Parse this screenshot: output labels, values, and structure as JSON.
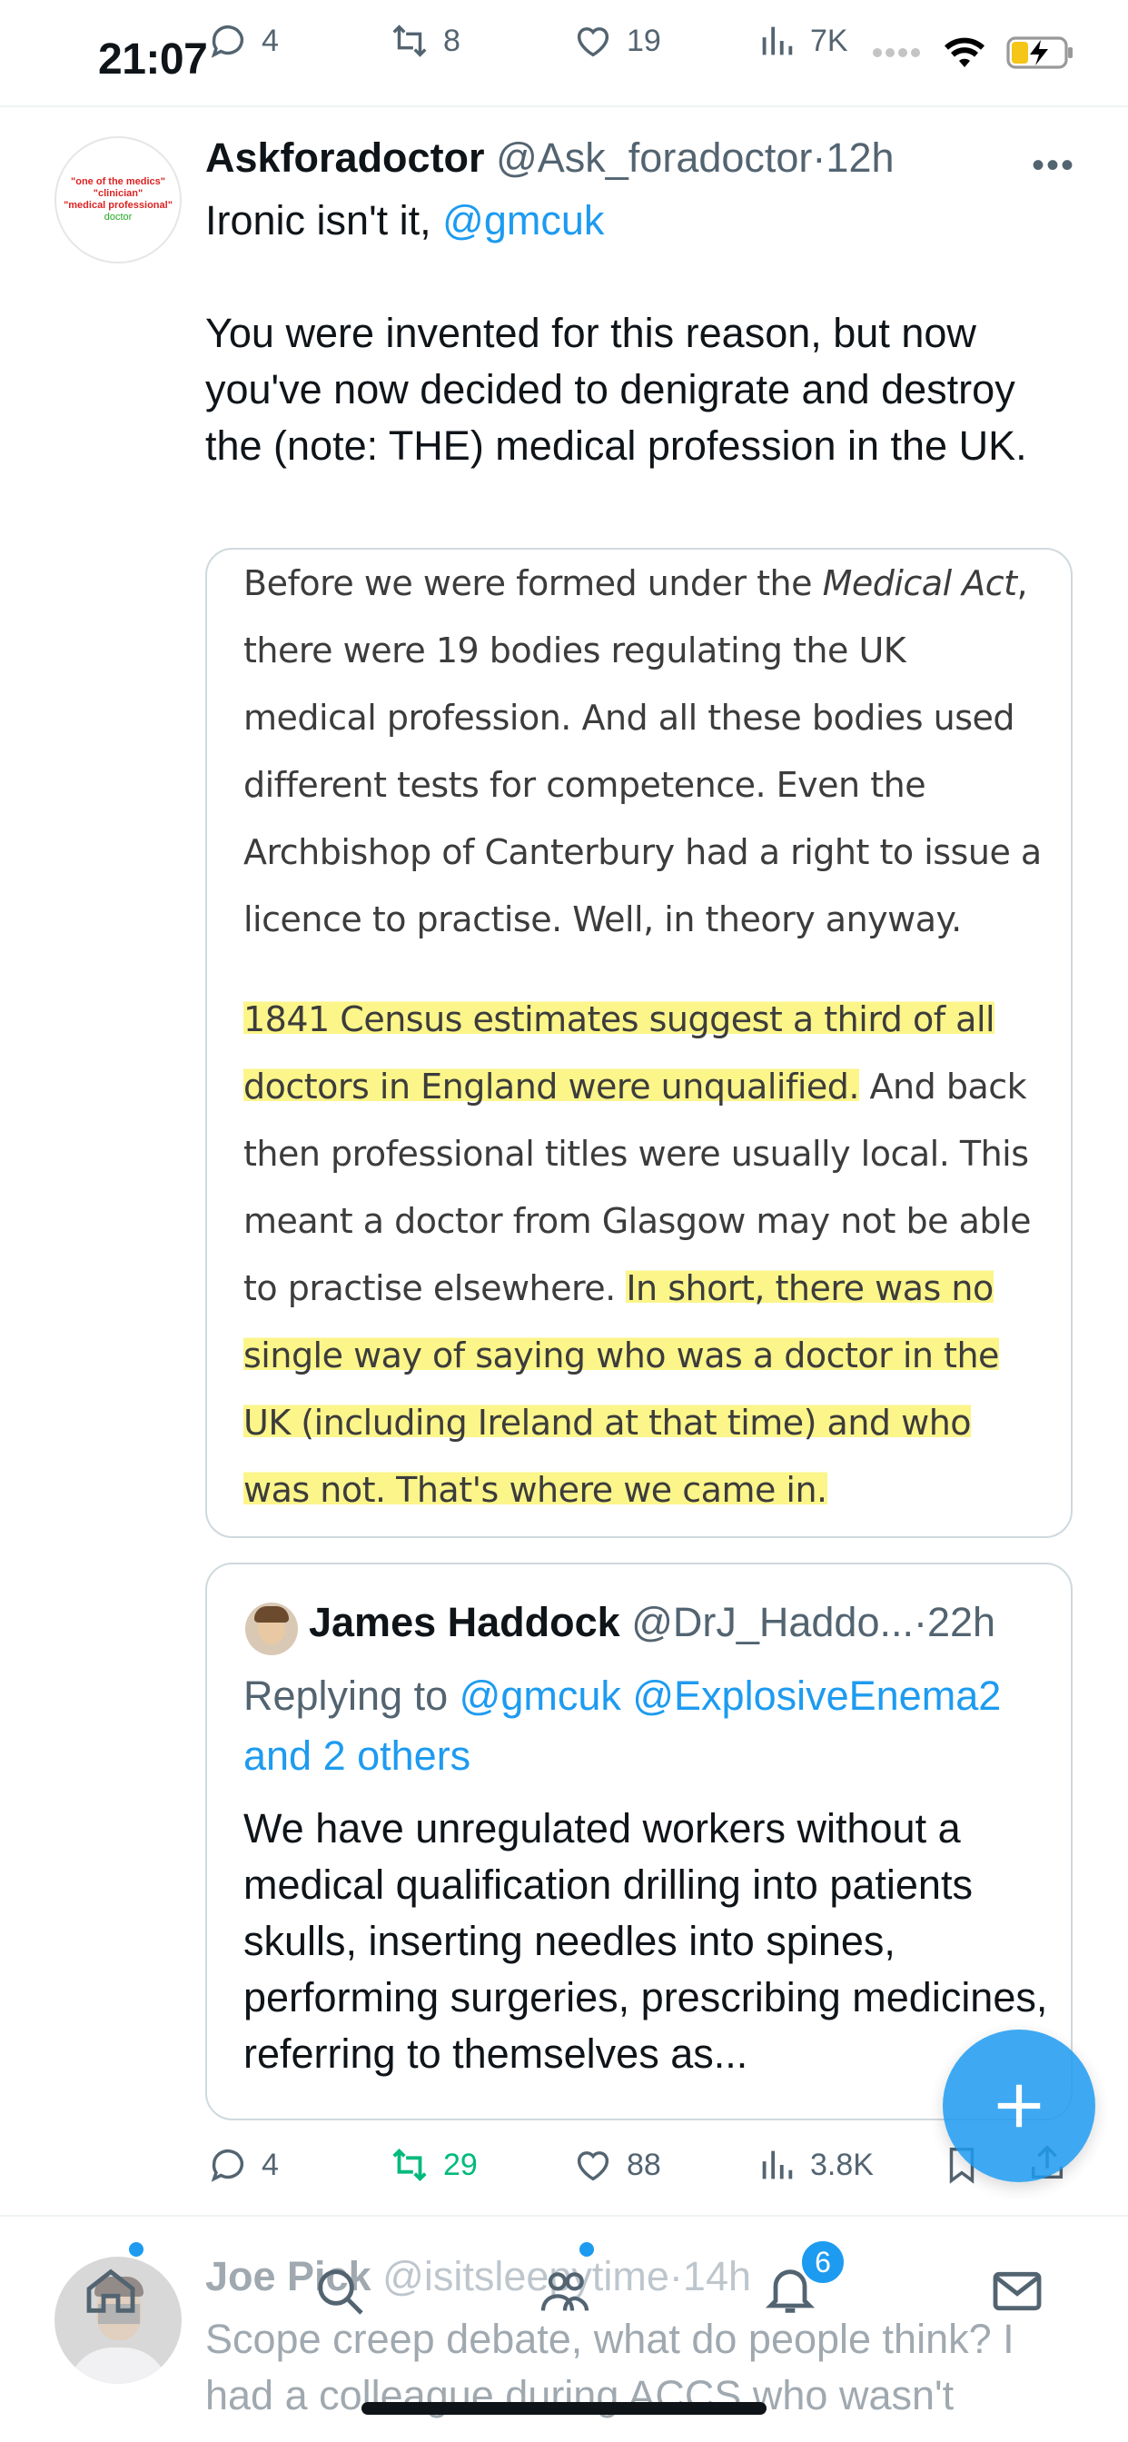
{
  "status_bar": {
    "time": "21:07"
  },
  "previous_tweet_actions": {
    "replies": "4",
    "reposts": "8",
    "likes": "19",
    "views": "7K"
  },
  "tweet": {
    "author_name": "Askforadoctor",
    "author_handle": "@Ask_foradoctor",
    "separator": "·",
    "timestamp": "12h",
    "avatar_lines": [
      "\"one of the medics\"",
      "\"clinician\"",
      "\"medical professional\"",
      "doctor"
    ],
    "text_line1_prefix": "Ironic isn't it, ",
    "text_line1_mention": "@gmcuk",
    "text_paragraph2": "You were invented for this reason, but now you've now decided to denigrate and destroy the (note: THE) medical profession in the UK."
  },
  "image_card": {
    "p1_before_italic": "Before we were formed under the ",
    "p1_italic": "Medical Act",
    "p1_after_italic": ", there were 19 bodies regulating the UK medical profession. And all these bodies used different tests for competence. Even the Archbishop of Canterbury had a right to issue a licence to practise. Well, in theory anyway.",
    "p2_highlight1": "1841 Census estimates suggest a third of all doctors in England were unqualified.",
    "p2_plain": " And back then professional titles were usually local. This meant a doctor from Glasgow may not be able to practise elsewhere. ",
    "p2_highlight2": "In short, there was no single way of saying who was a doctor in the UK (including Ireland at that time) and who was not. That's where we came in."
  },
  "quote": {
    "author_name": "James Haddock",
    "author_handle": "@DrJ_Haddo...",
    "separator": "·",
    "timestamp": "22h",
    "replying_prefix": "Replying to ",
    "replying_mentions": "@gmcuk @ExplosiveEnema2 and 2 others",
    "text": "We have unregulated workers without a medical qualification drilling into patients skulls, inserting needles into spines, performing surgeries, prescribing medicines, referring to themselves as..."
  },
  "actions": {
    "replies": "4",
    "reposts": "29",
    "likes": "88",
    "views": "3.8K"
  },
  "next_tweet": {
    "author_name": "Joe Pick",
    "author_handle": "@isitsleepytime",
    "separator": "·",
    "timestamp": "14h",
    "text": "Scope creep debate, what do people think? I had a colleague during ACCS who wasn't"
  },
  "tab_bar": {
    "notifications_badge": "6"
  },
  "colors": {
    "accent": "#1d9bf0",
    "retweet_green": "#00ba7c",
    "highlight": "#fbf58a",
    "secondary_text": "#536471"
  },
  "icons": [
    "reply-icon",
    "repost-icon",
    "like-icon",
    "views-icon",
    "bookmark-icon",
    "share-icon",
    "more-icon",
    "compose-icon",
    "home-icon",
    "search-icon",
    "communities-icon",
    "notifications-icon",
    "messages-icon"
  ]
}
